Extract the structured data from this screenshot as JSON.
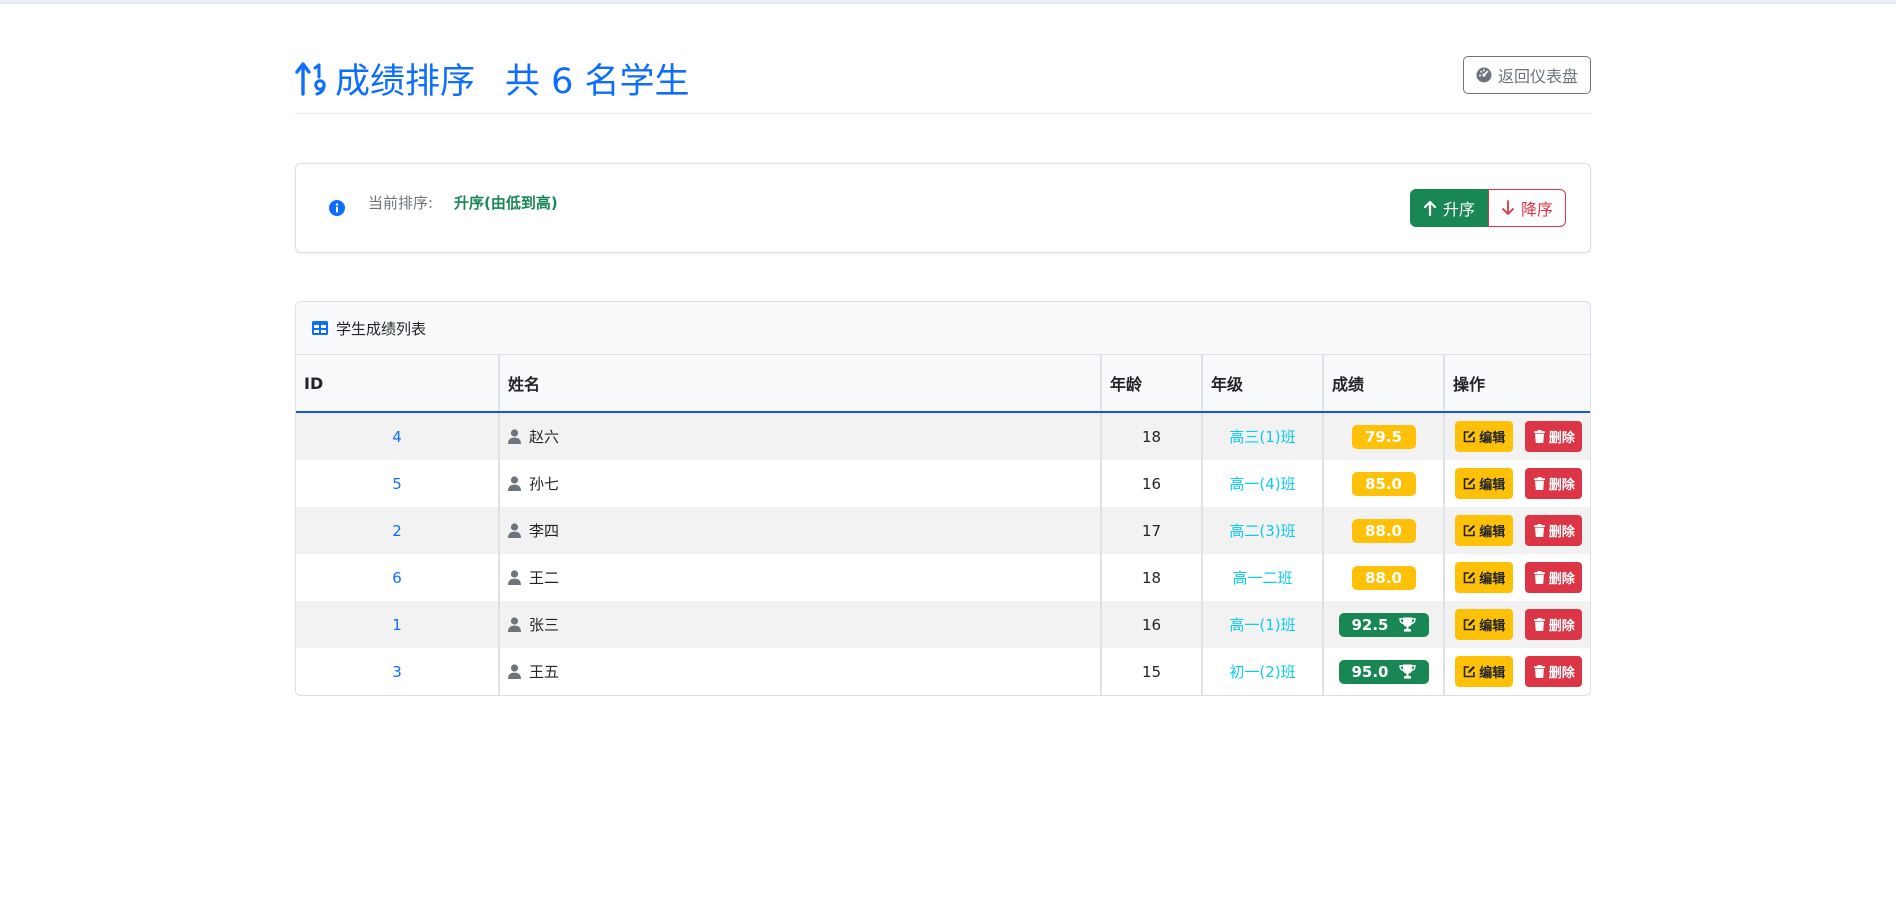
{
  "header": {
    "title": "成绩排序",
    "count_text": "共 6 名学生",
    "back_button": "返回仪表盘"
  },
  "sort": {
    "label": "当前排序:",
    "value": "升序(由低到高)",
    "asc_button": "升序",
    "desc_button": "降序"
  },
  "table": {
    "title": "学生成绩列表",
    "columns": [
      "ID",
      "姓名",
      "年龄",
      "年级",
      "成绩",
      "操作"
    ],
    "edit_label": "编辑",
    "delete_label": "删除",
    "rows": [
      {
        "id": "4",
        "name": "赵六",
        "age": "18",
        "grade": "高三(1)班",
        "score": "79.5",
        "top": false
      },
      {
        "id": "5",
        "name": "孙七",
        "age": "16",
        "grade": "高一(4)班",
        "score": "85.0",
        "top": false
      },
      {
        "id": "2",
        "name": "李四",
        "age": "17",
        "grade": "高二(3)班",
        "score": "88.0",
        "top": false
      },
      {
        "id": "6",
        "name": "王二",
        "age": "18",
        "grade": "高一二班",
        "score": "88.0",
        "top": false
      },
      {
        "id": "1",
        "name": "张三",
        "age": "16",
        "grade": "高一(1)班",
        "score": "92.5",
        "top": true
      },
      {
        "id": "3",
        "name": "王五",
        "age": "15",
        "grade": "初一(2)班",
        "score": "95.0",
        "top": true
      }
    ]
  },
  "colors": {
    "primary": "#0d6efd",
    "success": "#198754",
    "danger": "#dc3545",
    "warning": "#ffc107",
    "info": "#0dcaf0"
  },
  "icons": {
    "title": "sort-numeric-up-icon",
    "back": "speedometer-icon",
    "info": "info-circle-icon",
    "asc": "arrow-up-icon",
    "desc": "arrow-down-icon",
    "table": "table-icon",
    "user": "person-icon",
    "trophy": "trophy-icon",
    "edit": "pencil-square-icon",
    "delete": "trash-icon"
  }
}
